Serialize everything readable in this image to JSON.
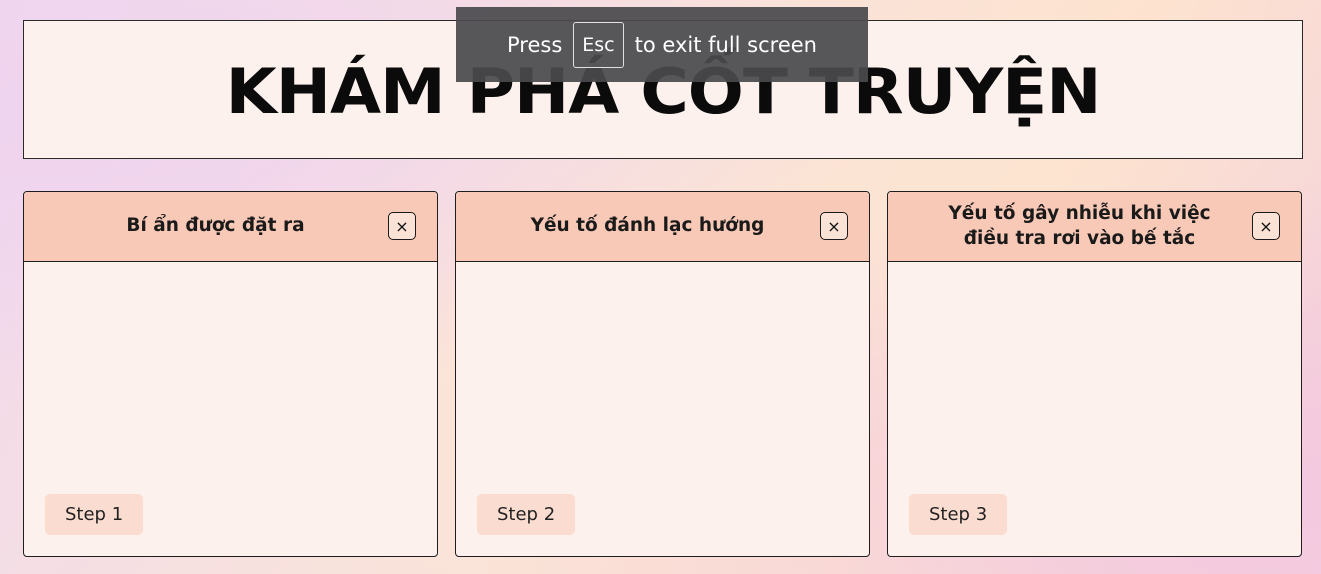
{
  "header": {
    "title": "KHÁM PHÁ CỐT TRUYỆN"
  },
  "cards": [
    {
      "title": "Bí ẩn được đặt ra",
      "close_label": "×",
      "step_label": "Step 1"
    },
    {
      "title": "Yếu tố đánh lạc hướng",
      "close_label": "×",
      "step_label": "Step 2"
    },
    {
      "title": "Yếu tố gây nhiễu khi việc điều tra rơi vào bế tắc",
      "close_label": "×",
      "step_label": "Step 3"
    }
  ],
  "fullscreen_notice": {
    "press": "Press",
    "key": "Esc",
    "rest": "to exit full screen"
  },
  "colors": {
    "card_header": "#f9c9b7",
    "card_body": "#fdf1ed",
    "step_badge": "#fbdcd0",
    "overlay": "#4a4a4e"
  }
}
